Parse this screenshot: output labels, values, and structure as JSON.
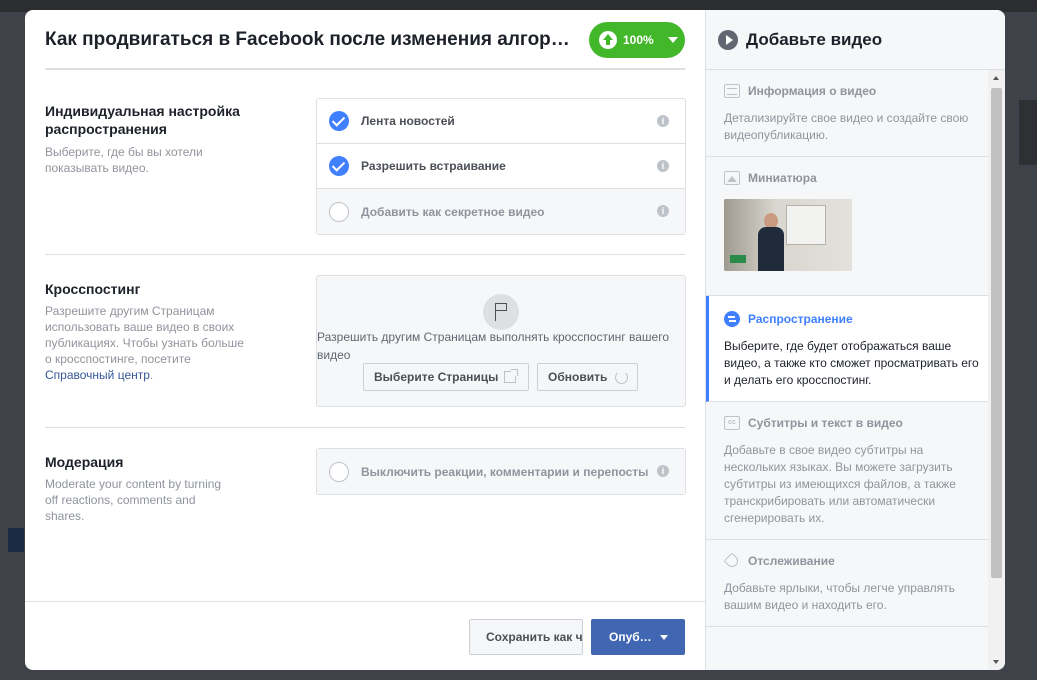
{
  "main": {
    "title": "Как продвигаться в Facebook после изменения алгоритма",
    "progress": "100%",
    "distribution": {
      "title": "Индивидуальная настройка распространения",
      "desc": "Выберите, где бы вы хотели показывать видео.",
      "options": [
        {
          "label": "Лента новостей",
          "checked": true
        },
        {
          "label": "Разрешить встраивание",
          "checked": true
        },
        {
          "label": "Добавить как секретное видео",
          "checked": false
        }
      ]
    },
    "crossposting": {
      "title": "Кросспостинг",
      "desc": "Разрешите другим Страницам использовать ваше видео в своих публикациях. Чтобы узнать больше о кросспостинге, посетите ",
      "link": "Справочный центр",
      "desc_end": ".",
      "box_text": "Разрешить другим Страницам выполнять кросспостинг вашего видео",
      "select_pages": "Выберите Страницы",
      "refresh": "Обновить"
    },
    "moderation": {
      "title": "Модерация",
      "desc": "Moderate your content by turning off reactions, comments and shares.",
      "option": "Выключить реакции, комментарии и перепосты"
    },
    "footer": {
      "save": "Сохранить как черновик",
      "publish": "Опуб…"
    }
  },
  "side": {
    "title": "Добавьте видео",
    "steps": [
      {
        "label": "Информация о видео",
        "desc": "Детализируйте свое видео и создайте свою видеопубликацию.",
        "icon": "doc-icon"
      },
      {
        "label": "Миниатюра",
        "desc": "",
        "icon": "image-icon"
      },
      {
        "label": "Распространение",
        "desc": "Выберите, где будет отображаться ваше видео, а также кто сможет просматривать его и делать его кросспостинг.",
        "icon": "share-icon"
      },
      {
        "label": "Субтитры и текст в видео",
        "desc": "Добавьте в свое видео субтитры на нескольких языках. Вы можете загрузить субтитры из имеющихся файлов, а также транскрибировать или автоматически сгенерировать их.",
        "icon": "cc-icon"
      },
      {
        "label": "Отслеживание",
        "desc": "Добавьте ярлыки, чтобы легче управлять вашим видео и находить его.",
        "icon": "tag-icon"
      }
    ]
  },
  "colors": {
    "accent": "#4080ff",
    "green": "#42b72a",
    "publish": "#4267b2"
  }
}
